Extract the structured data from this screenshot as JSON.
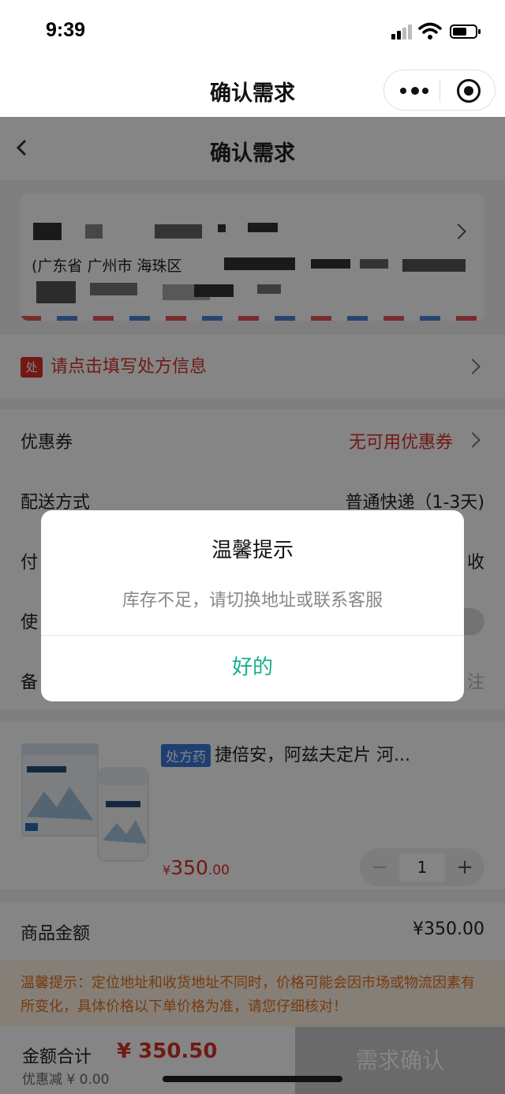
{
  "status_bar": {
    "time": "9:39"
  },
  "mini_program_nav": {
    "title": "确认需求"
  },
  "page_nav": {
    "title": "确认需求"
  },
  "address": {
    "region": "(广东省 广州市 海珠区"
  },
  "prescription": {
    "badge": "处",
    "text": "请点击填写处方信息"
  },
  "options": {
    "coupon": {
      "label": "优惠券",
      "value": "无可用优惠券"
    },
    "delivery": {
      "label": "配送方式",
      "value": "普通快递（1-3天)"
    },
    "payment": {
      "label": "付",
      "value": "收"
    },
    "use": {
      "label": "使"
    },
    "remark": {
      "label": "备",
      "value": "注"
    }
  },
  "product": {
    "tag": "处方药",
    "name": "捷倍安，阿兹夫定片 河...",
    "price_symbol": "¥",
    "price_int": "350",
    "price_dec": ".00",
    "quantity": "1",
    "minus": "−",
    "plus": "+"
  },
  "amount": {
    "label": "商品金额",
    "value": "¥350.00"
  },
  "notice": {
    "text": "温馨提示：定位地址和收货地址不同时，价格可能会因市场或物流因素有所变化，具体价格以下单价格为准，请您仔细核对！"
  },
  "bottom_bar": {
    "total_label": "金额合计",
    "total_value": "¥ 350.50",
    "discount": "优惠减 ¥ 0.00",
    "confirm_label": "需求确认"
  },
  "modal": {
    "title": "温馨提示",
    "message": "库存不足，请切换地址或联系客服",
    "ok_label": "好的"
  },
  "colors": {
    "accent_red": "#d8312a",
    "modal_ok": "#1aad8a",
    "notice_text": "#e2721d"
  }
}
